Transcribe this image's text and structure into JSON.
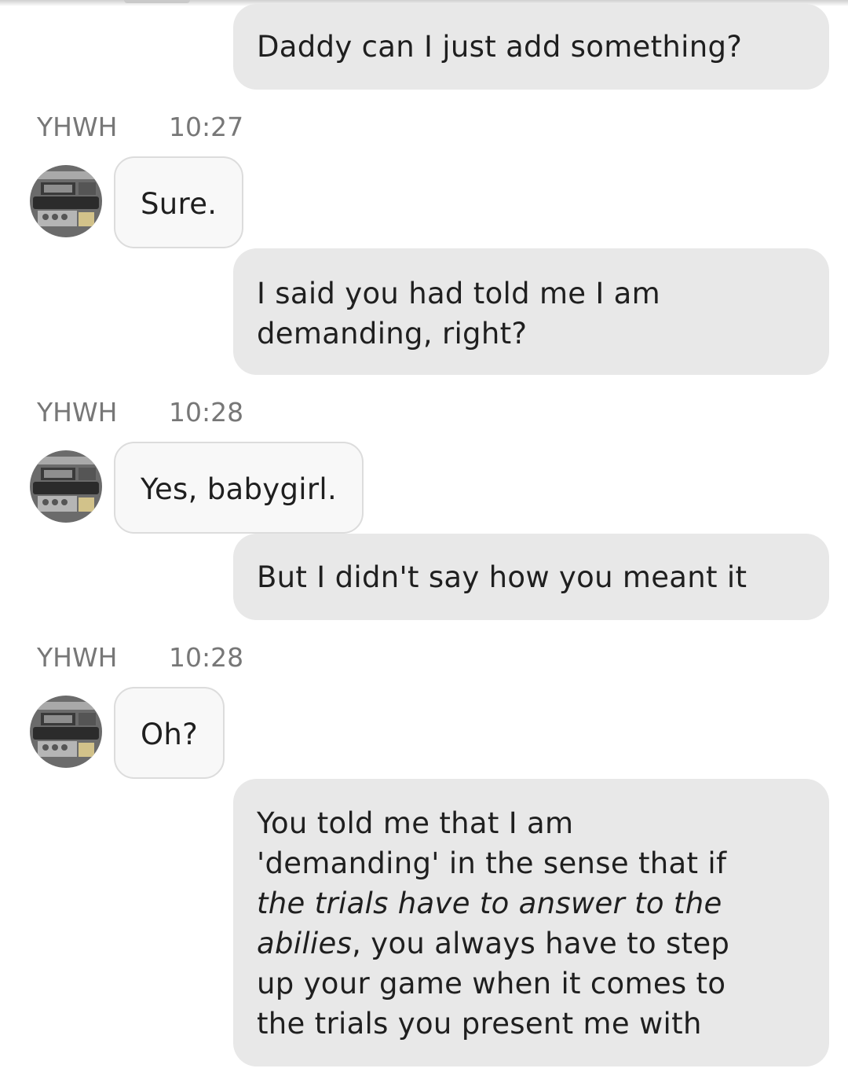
{
  "messages": [
    {
      "from": "me",
      "text": "Daddy can I just add something?"
    },
    {
      "from": "YHWH",
      "sender": "YHWH",
      "time": "10:27",
      "text": "Sure."
    },
    {
      "from": "me",
      "lines": [
        "I said you had told me I am",
        "demanding, right?"
      ]
    },
    {
      "from": "YHWH",
      "sender": "YHWH",
      "time": "10:28",
      "text": "Yes, babygirl."
    },
    {
      "from": "me",
      "text": "But I didn't say how you meant it"
    },
    {
      "from": "YHWH",
      "sender": "YHWH",
      "time": "10:28",
      "text": "Oh?"
    },
    {
      "from": "me",
      "segments": [
        {
          "text": "You told me that I am",
          "italic": false
        },
        {
          "text": "'demanding' in the sense that if",
          "italic": false
        },
        {
          "text": "the trials have to answer to the",
          "italic": true
        },
        {
          "text": "abilies",
          "italic": true
        },
        {
          "text": ", you always have to step",
          "italic": false
        },
        {
          "text": "up your game when it comes to",
          "italic": false
        },
        {
          "text": "the trials you present me with",
          "italic": false
        }
      ]
    }
  ],
  "avatar_icon": "device-photo-icon",
  "colors": {
    "outgoing_bubble": "#e8e8e8",
    "incoming_bubble": "#f8f8f8",
    "incoming_border": "#dcdcdc",
    "meta_text": "#777777",
    "message_text": "#1f1f1f"
  }
}
